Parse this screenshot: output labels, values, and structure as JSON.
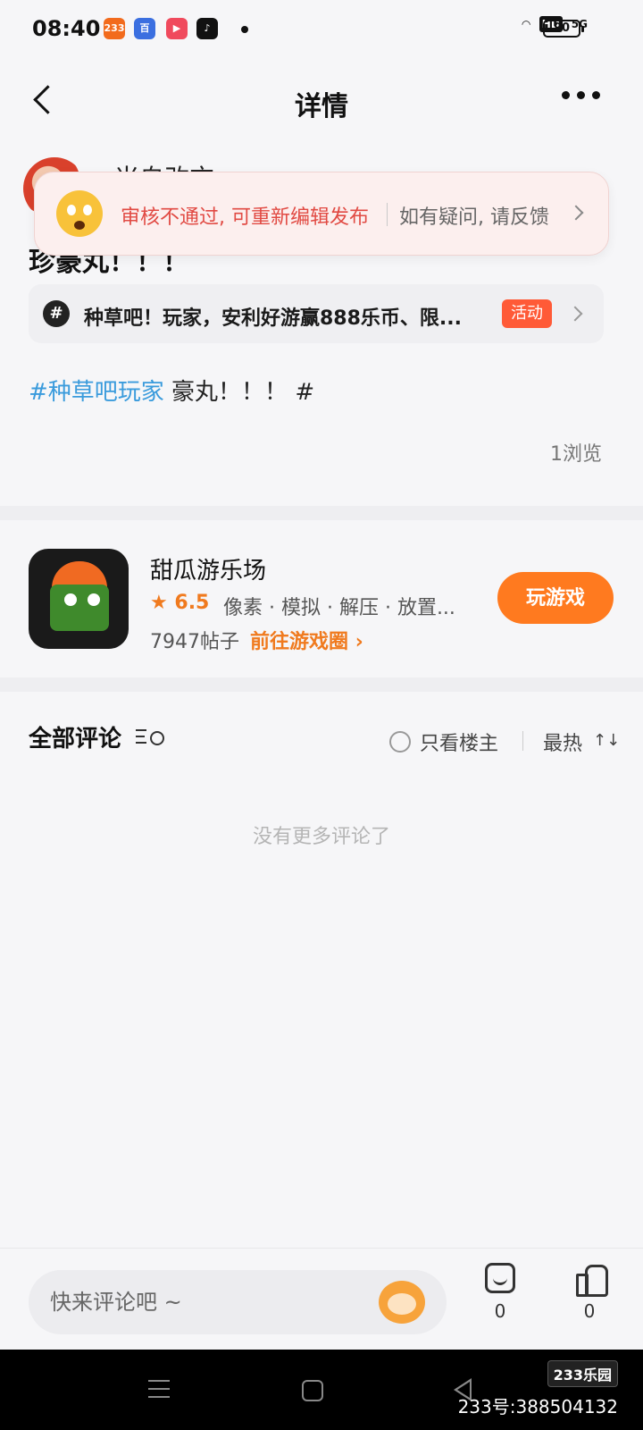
{
  "status_bar": {
    "time": "08:40",
    "app_icons": [
      "233",
      "baidu",
      "video",
      "tiktok"
    ],
    "network": "5G",
    "hd": "HD",
    "battery": "90"
  },
  "nav": {
    "title": "详情"
  },
  "post": {
    "author_name": "米自改充",
    "title_partial": "珍豪丸！！！",
    "review_toast": {
      "status_text": "审核不通过, 可重新编辑发布",
      "feedback_text": "如有疑问, 请反馈"
    },
    "topic": {
      "text": "种草吧！玩家，安利好游赢888乐币、限...",
      "badge": "活动"
    },
    "content_tag": "#种草吧玩家",
    "content_text": " 豪丸！！！ #",
    "views": "1浏览"
  },
  "game": {
    "name": "甜瓜游乐场",
    "rating": "6.5",
    "tags": "像素 · 模拟 · 解压 · 放置...",
    "post_count": "7947帖子",
    "goto_circle": "前往游戏圈",
    "play_label": "玩游戏"
  },
  "comments": {
    "title": "全部评论",
    "only_owner": "只看楼主",
    "sort": "最热",
    "empty_text": "没有更多评论了"
  },
  "bottom_bar": {
    "input_placeholder": "快来评论吧 ~",
    "comment_count": "0",
    "like_count": "0"
  },
  "watermark": {
    "logo": "233乐园",
    "id_text": "233号:388504132"
  },
  "colors": {
    "accent": "#ff7a1f",
    "error": "#e14a43",
    "link": "#3a9bdc"
  }
}
